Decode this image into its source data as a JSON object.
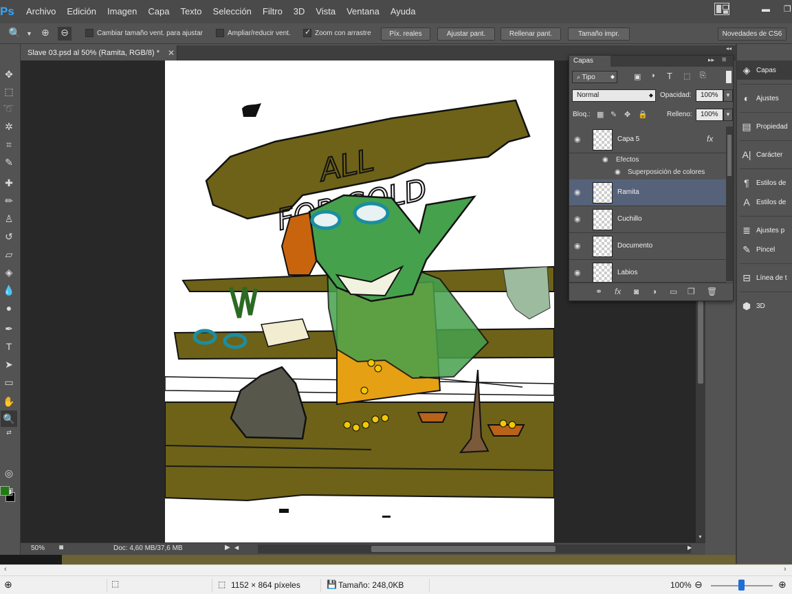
{
  "app": {
    "logo": "Ps",
    "menu": [
      "Archivo",
      "Edición",
      "Imagen",
      "Capa",
      "Texto",
      "Selección",
      "Filtro",
      "3D",
      "Vista",
      "Ventana",
      "Ayuda"
    ]
  },
  "options_bar": {
    "checks": [
      {
        "label": "Cambiar tamaño vent. para ajustar",
        "checked": false
      },
      {
        "label": "Ampliar/reducir vent.",
        "checked": false
      },
      {
        "label": "Zoom con arrastre",
        "checked": true
      }
    ],
    "buttons": [
      "Píx. reales",
      "Ajustar pant.",
      "Rellenar pant.",
      "Tamaño impr."
    ],
    "whats_new": "Novedades de CS6"
  },
  "document": {
    "tab_title": "Slave 03.psd al 50% (Ramita, RGB/8) *",
    "zoom": "50%",
    "doc_info": "Doc: 4,60 MB/37,6 MB",
    "sign_line1": "ALL",
    "sign_line2": "FOR GOLD"
  },
  "layers_panel": {
    "tab": "Capas",
    "filter": "Tipo",
    "blend_mode": "Normal",
    "opacity_label": "Opacidad:",
    "opacity": "100%",
    "lock_label": "Bloq.:",
    "fill_label": "Relleno:",
    "fill": "100%",
    "layers": [
      {
        "name": "Capa 5",
        "has_fx": true,
        "selected": false
      },
      {
        "name": "Ramita",
        "has_fx": false,
        "selected": true
      },
      {
        "name": "Cuchillo",
        "has_fx": false,
        "selected": false
      },
      {
        "name": "Documento",
        "has_fx": false,
        "selected": false
      },
      {
        "name": "Labios",
        "has_fx": false,
        "selected": false
      }
    ],
    "effects_label": "Efectos",
    "effect_name": "Superposición de colores",
    "fx_symbol": "fx"
  },
  "dock": {
    "items": [
      "Capas",
      "Ajustes",
      "Propiedad",
      "Carácter",
      "Estilos de",
      "Estilos de",
      "Ajustes p",
      "Pincel",
      "Línea de t",
      "3D"
    ]
  },
  "os_status": {
    "dimensions": "1152 × 864 píxeles",
    "size": "Tamaño: 248,0KB",
    "zoom": "100%"
  },
  "colors": {
    "foreground": "#1f7a12",
    "background": "#000000",
    "selected_layer": "#56627a"
  }
}
